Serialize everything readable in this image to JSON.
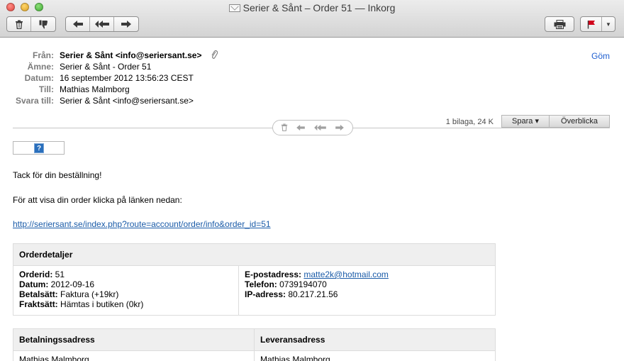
{
  "window": {
    "title": "Serier & Sånt – Order 51 — Inkorg"
  },
  "toolbar": {
    "delete_icon": "trash-icon",
    "junk_icon": "thumbs-down-icon",
    "reply_icon": "reply-icon",
    "reply_all_icon": "reply-all-icon",
    "forward_icon": "forward-icon",
    "print_icon": "printer-icon",
    "flag_icon": "flag-icon",
    "flag_color": "#d0021b"
  },
  "header": {
    "from_label": "Från:",
    "from_value": "Serier & Sånt <info@seriersant.se>",
    "subject_label": "Ämne:",
    "subject_value": "Serier & Sånt - Order 51",
    "date_label": "Datum:",
    "date_value": "16 september 2012 13:56:23 CEST",
    "to_label": "Till:",
    "to_value": "Mathias Malmborg",
    "reply_to_label": "Svara till:",
    "reply_to_value": "Serier & Sånt <info@seriersant.se>",
    "hide_label": "Göm"
  },
  "attachments": {
    "info": "1 bilaga, 24 K",
    "save_label": "Spara ▾",
    "quicklook_label": "Överblicka"
  },
  "body": {
    "image_placeholder": "?",
    "thanks": "Tack för din beställning!",
    "view_order": "För att visa din order klicka på länken nedan:",
    "order_link": "http://seriersant.se/index.php?route=account/order/info&order_id=51",
    "details_header": "Orderdetaljer",
    "order_id_label": "Orderid:",
    "order_id_value": " 51",
    "date_label": "Datum:",
    "date_value": " 2012-09-16",
    "payment_label": "Betalsätt:",
    "payment_value": " Faktura (+19kr)",
    "shipping_label": "Fraktsätt:",
    "shipping_value": " Hämtas i butiken (0kr)",
    "email_label": "E-postadress:",
    "email_value": "matte2k@hotmail.com",
    "phone_label": "Telefon:",
    "phone_value": " 0739194070",
    "ip_label": "IP-adress:",
    "ip_value": " 80.217.21.56",
    "billing_header": "Betalningssadress",
    "delivery_header": "Leveransadress",
    "billing_name": "Mathias Malmborg",
    "delivery_name": "Mathias Malmborg"
  }
}
